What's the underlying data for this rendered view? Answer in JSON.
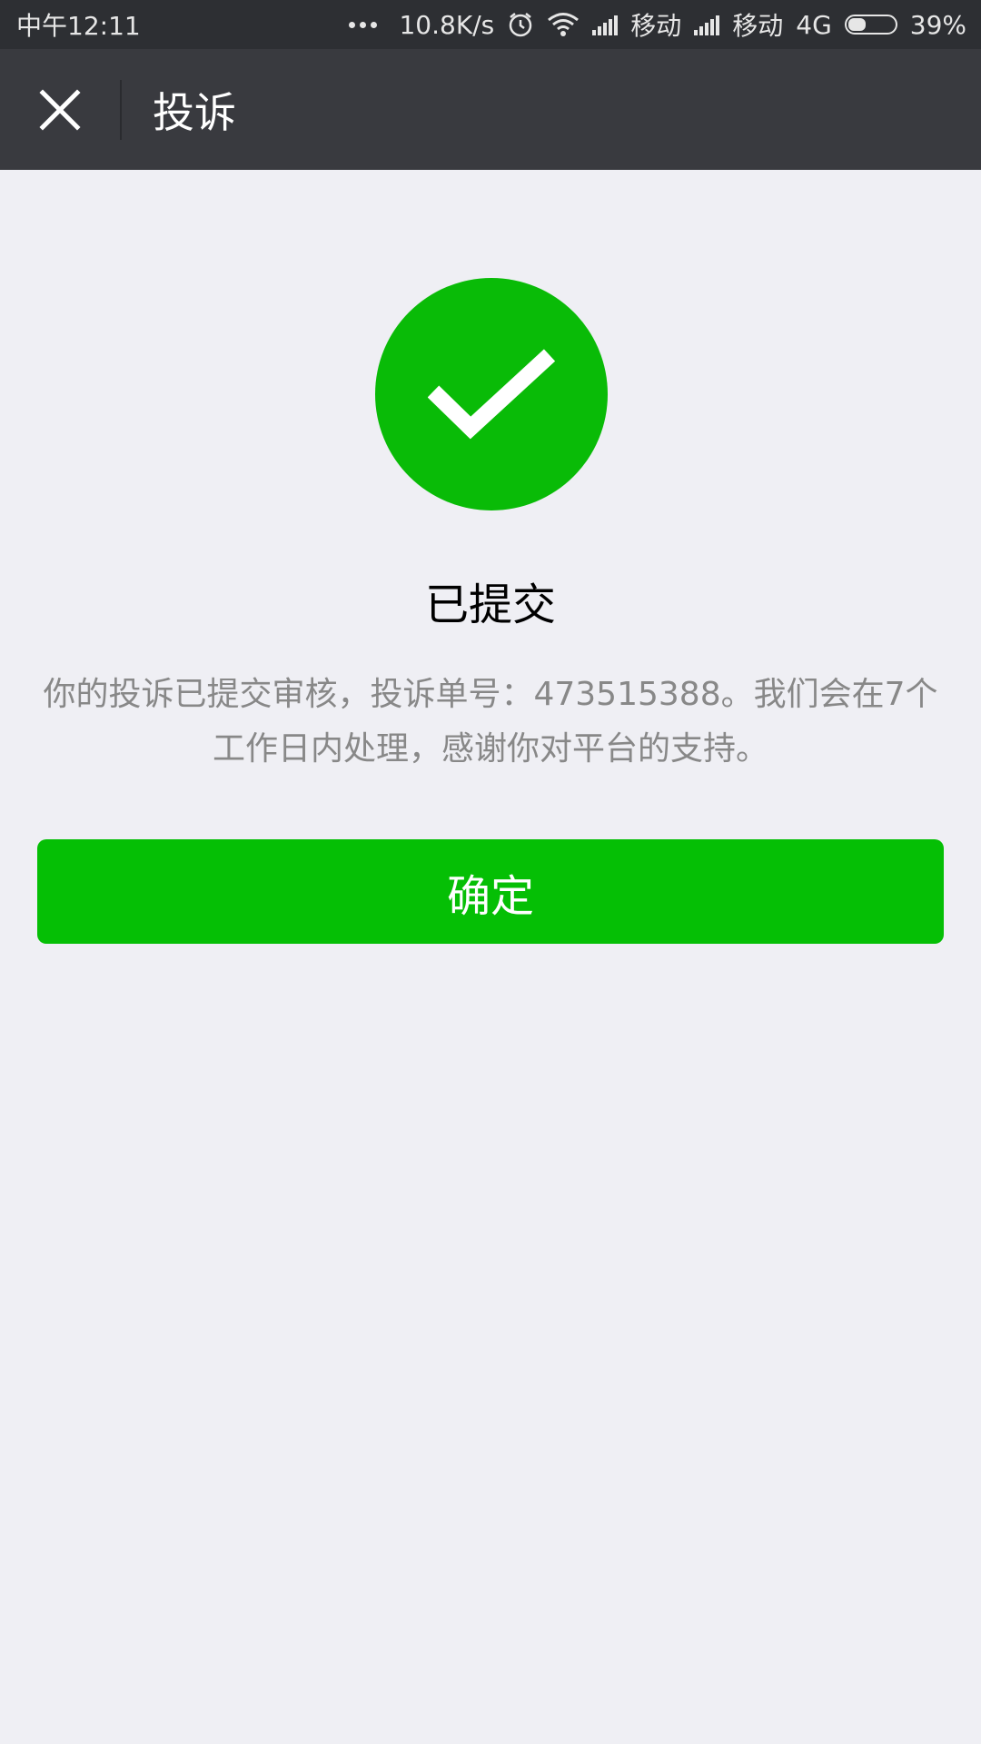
{
  "status_bar": {
    "time": "中午12:11",
    "net_speed": "10.8K/s",
    "carrier1": "移动",
    "carrier2": "移动",
    "network_type": "4G",
    "battery": "39%",
    "battery_level": 0.39
  },
  "header": {
    "title": "投诉"
  },
  "result": {
    "title": "已提交",
    "description": "你的投诉已提交审核，投诉单号：473515388。我们会在7个工作日内处理，感谢你对平台的支持。",
    "confirm_label": "确定"
  },
  "colors": {
    "success_green": "#09bb07",
    "button_green": "#05bf05",
    "nav_bg": "#393a3f",
    "page_bg": "#efeff4"
  }
}
